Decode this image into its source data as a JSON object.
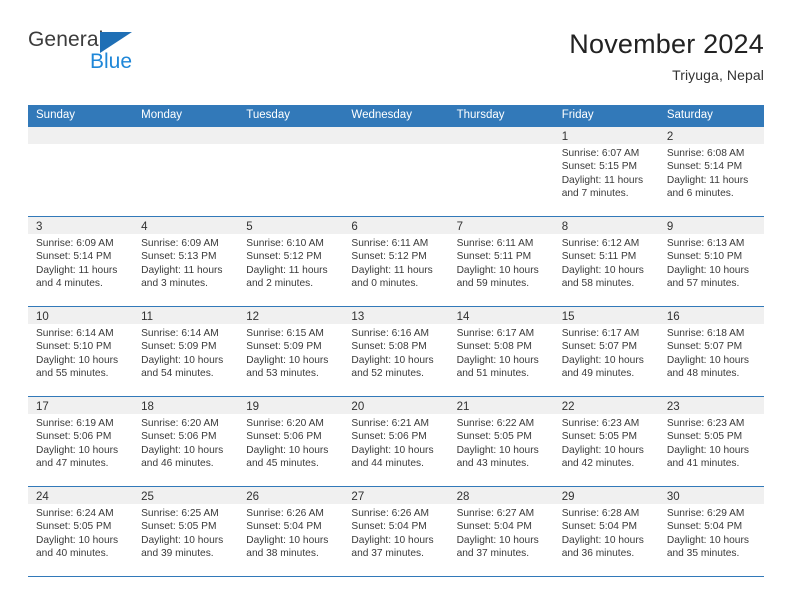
{
  "brand": {
    "name_part1": "General",
    "name_part2": "Blue",
    "triangle_color": "#1f6fb5",
    "blue_color": "#1f87d8"
  },
  "header": {
    "title": "November 2024",
    "location": "Triyuga, Nepal"
  },
  "theme": {
    "header_blue": "#3279b9",
    "numstrip_gray": "#f0f0f0",
    "text_color": "#3a3a3a"
  },
  "weekday_headers": [
    "Sunday",
    "Monday",
    "Tuesday",
    "Wednesday",
    "Thursday",
    "Friday",
    "Saturday"
  ],
  "weeks": [
    [
      {
        "day": "",
        "sunrise": "",
        "sunset": "",
        "daylight_line1": "",
        "daylight_line2": ""
      },
      {
        "day": "",
        "sunrise": "",
        "sunset": "",
        "daylight_line1": "",
        "daylight_line2": ""
      },
      {
        "day": "",
        "sunrise": "",
        "sunset": "",
        "daylight_line1": "",
        "daylight_line2": ""
      },
      {
        "day": "",
        "sunrise": "",
        "sunset": "",
        "daylight_line1": "",
        "daylight_line2": ""
      },
      {
        "day": "",
        "sunrise": "",
        "sunset": "",
        "daylight_line1": "",
        "daylight_line2": ""
      },
      {
        "day": "1",
        "sunrise": "Sunrise: 6:07 AM",
        "sunset": "Sunset: 5:15 PM",
        "daylight_line1": "Daylight: 11 hours",
        "daylight_line2": "and 7 minutes."
      },
      {
        "day": "2",
        "sunrise": "Sunrise: 6:08 AM",
        "sunset": "Sunset: 5:14 PM",
        "daylight_line1": "Daylight: 11 hours",
        "daylight_line2": "and 6 minutes."
      }
    ],
    [
      {
        "day": "3",
        "sunrise": "Sunrise: 6:09 AM",
        "sunset": "Sunset: 5:14 PM",
        "daylight_line1": "Daylight: 11 hours",
        "daylight_line2": "and 4 minutes."
      },
      {
        "day": "4",
        "sunrise": "Sunrise: 6:09 AM",
        "sunset": "Sunset: 5:13 PM",
        "daylight_line1": "Daylight: 11 hours",
        "daylight_line2": "and 3 minutes."
      },
      {
        "day": "5",
        "sunrise": "Sunrise: 6:10 AM",
        "sunset": "Sunset: 5:12 PM",
        "daylight_line1": "Daylight: 11 hours",
        "daylight_line2": "and 2 minutes."
      },
      {
        "day": "6",
        "sunrise": "Sunrise: 6:11 AM",
        "sunset": "Sunset: 5:12 PM",
        "daylight_line1": "Daylight: 11 hours",
        "daylight_line2": "and 0 minutes."
      },
      {
        "day": "7",
        "sunrise": "Sunrise: 6:11 AM",
        "sunset": "Sunset: 5:11 PM",
        "daylight_line1": "Daylight: 10 hours",
        "daylight_line2": "and 59 minutes."
      },
      {
        "day": "8",
        "sunrise": "Sunrise: 6:12 AM",
        "sunset": "Sunset: 5:11 PM",
        "daylight_line1": "Daylight: 10 hours",
        "daylight_line2": "and 58 minutes."
      },
      {
        "day": "9",
        "sunrise": "Sunrise: 6:13 AM",
        "sunset": "Sunset: 5:10 PM",
        "daylight_line1": "Daylight: 10 hours",
        "daylight_line2": "and 57 minutes."
      }
    ],
    [
      {
        "day": "10",
        "sunrise": "Sunrise: 6:14 AM",
        "sunset": "Sunset: 5:10 PM",
        "daylight_line1": "Daylight: 10 hours",
        "daylight_line2": "and 55 minutes."
      },
      {
        "day": "11",
        "sunrise": "Sunrise: 6:14 AM",
        "sunset": "Sunset: 5:09 PM",
        "daylight_line1": "Daylight: 10 hours",
        "daylight_line2": "and 54 minutes."
      },
      {
        "day": "12",
        "sunrise": "Sunrise: 6:15 AM",
        "sunset": "Sunset: 5:09 PM",
        "daylight_line1": "Daylight: 10 hours",
        "daylight_line2": "and 53 minutes."
      },
      {
        "day": "13",
        "sunrise": "Sunrise: 6:16 AM",
        "sunset": "Sunset: 5:08 PM",
        "daylight_line1": "Daylight: 10 hours",
        "daylight_line2": "and 52 minutes."
      },
      {
        "day": "14",
        "sunrise": "Sunrise: 6:17 AM",
        "sunset": "Sunset: 5:08 PM",
        "daylight_line1": "Daylight: 10 hours",
        "daylight_line2": "and 51 minutes."
      },
      {
        "day": "15",
        "sunrise": "Sunrise: 6:17 AM",
        "sunset": "Sunset: 5:07 PM",
        "daylight_line1": "Daylight: 10 hours",
        "daylight_line2": "and 49 minutes."
      },
      {
        "day": "16",
        "sunrise": "Sunrise: 6:18 AM",
        "sunset": "Sunset: 5:07 PM",
        "daylight_line1": "Daylight: 10 hours",
        "daylight_line2": "and 48 minutes."
      }
    ],
    [
      {
        "day": "17",
        "sunrise": "Sunrise: 6:19 AM",
        "sunset": "Sunset: 5:06 PM",
        "daylight_line1": "Daylight: 10 hours",
        "daylight_line2": "and 47 minutes."
      },
      {
        "day": "18",
        "sunrise": "Sunrise: 6:20 AM",
        "sunset": "Sunset: 5:06 PM",
        "daylight_line1": "Daylight: 10 hours",
        "daylight_line2": "and 46 minutes."
      },
      {
        "day": "19",
        "sunrise": "Sunrise: 6:20 AM",
        "sunset": "Sunset: 5:06 PM",
        "daylight_line1": "Daylight: 10 hours",
        "daylight_line2": "and 45 minutes."
      },
      {
        "day": "20",
        "sunrise": "Sunrise: 6:21 AM",
        "sunset": "Sunset: 5:06 PM",
        "daylight_line1": "Daylight: 10 hours",
        "daylight_line2": "and 44 minutes."
      },
      {
        "day": "21",
        "sunrise": "Sunrise: 6:22 AM",
        "sunset": "Sunset: 5:05 PM",
        "daylight_line1": "Daylight: 10 hours",
        "daylight_line2": "and 43 minutes."
      },
      {
        "day": "22",
        "sunrise": "Sunrise: 6:23 AM",
        "sunset": "Sunset: 5:05 PM",
        "daylight_line1": "Daylight: 10 hours",
        "daylight_line2": "and 42 minutes."
      },
      {
        "day": "23",
        "sunrise": "Sunrise: 6:23 AM",
        "sunset": "Sunset: 5:05 PM",
        "daylight_line1": "Daylight: 10 hours",
        "daylight_line2": "and 41 minutes."
      }
    ],
    [
      {
        "day": "24",
        "sunrise": "Sunrise: 6:24 AM",
        "sunset": "Sunset: 5:05 PM",
        "daylight_line1": "Daylight: 10 hours",
        "daylight_line2": "and 40 minutes."
      },
      {
        "day": "25",
        "sunrise": "Sunrise: 6:25 AM",
        "sunset": "Sunset: 5:05 PM",
        "daylight_line1": "Daylight: 10 hours",
        "daylight_line2": "and 39 minutes."
      },
      {
        "day": "26",
        "sunrise": "Sunrise: 6:26 AM",
        "sunset": "Sunset: 5:04 PM",
        "daylight_line1": "Daylight: 10 hours",
        "daylight_line2": "and 38 minutes."
      },
      {
        "day": "27",
        "sunrise": "Sunrise: 6:26 AM",
        "sunset": "Sunset: 5:04 PM",
        "daylight_line1": "Daylight: 10 hours",
        "daylight_line2": "and 37 minutes."
      },
      {
        "day": "28",
        "sunrise": "Sunrise: 6:27 AM",
        "sunset": "Sunset: 5:04 PM",
        "daylight_line1": "Daylight: 10 hours",
        "daylight_line2": "and 37 minutes."
      },
      {
        "day": "29",
        "sunrise": "Sunrise: 6:28 AM",
        "sunset": "Sunset: 5:04 PM",
        "daylight_line1": "Daylight: 10 hours",
        "daylight_line2": "and 36 minutes."
      },
      {
        "day": "30",
        "sunrise": "Sunrise: 6:29 AM",
        "sunset": "Sunset: 5:04 PM",
        "daylight_line1": "Daylight: 10 hours",
        "daylight_line2": "and 35 minutes."
      }
    ]
  ]
}
